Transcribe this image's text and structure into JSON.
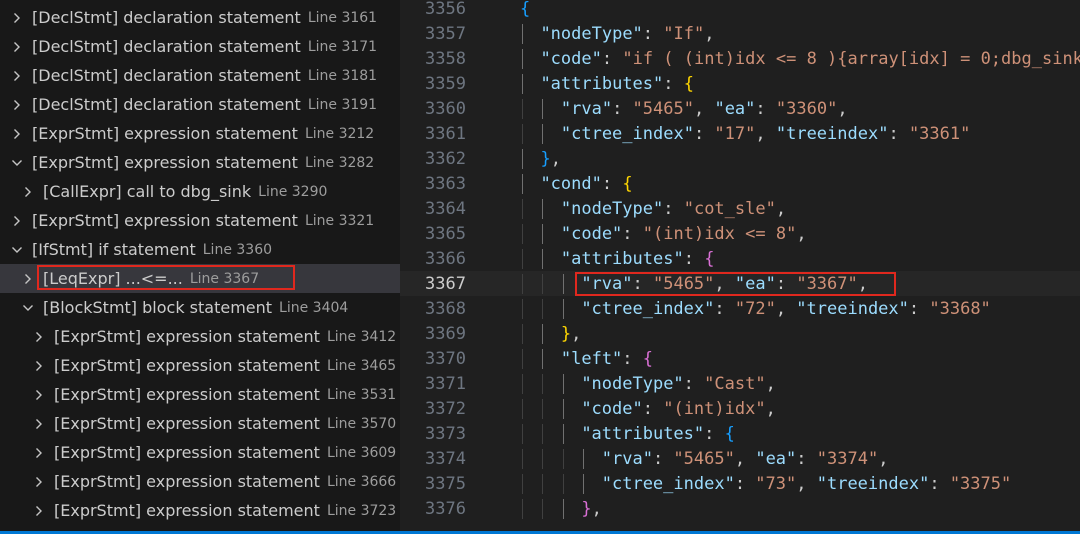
{
  "outline": {
    "items": [
      {
        "label": "[DeclStmt] declaration statement",
        "line": "Line 3161",
        "chevron": "right"
      },
      {
        "label": "[DeclStmt] declaration statement",
        "line": "Line 3171",
        "chevron": "right"
      },
      {
        "label": "[DeclStmt] declaration statement",
        "line": "Line 3181",
        "chevron": "right"
      },
      {
        "label": "[DeclStmt] declaration statement",
        "line": "Line 3191",
        "chevron": "right"
      },
      {
        "label": "[ExprStmt] expression statement",
        "line": "Line 3212",
        "chevron": "right"
      },
      {
        "label": "[ExprStmt] expression statement",
        "line": "Line 3282",
        "chevron": "down"
      },
      {
        "label": "[CallExpr] call to dbg_sink",
        "line": "Line 3290",
        "chevron": "right"
      },
      {
        "label": "[ExprStmt] expression statement",
        "line": "Line 3321",
        "chevron": "right"
      },
      {
        "label": "[IfStmt] if statement",
        "line": "Line 3360",
        "chevron": "down"
      },
      {
        "label": "[LeqExpr] ...<=...",
        "line": "Line 3367",
        "chevron": "right"
      },
      {
        "label": "[BlockStmt] block statement",
        "line": "Line 3404",
        "chevron": "down"
      },
      {
        "label": "[ExprStmt] expression statement",
        "line": "Line 3412",
        "chevron": "right"
      },
      {
        "label": "[ExprStmt] expression statement",
        "line": "Line 3465",
        "chevron": "right"
      },
      {
        "label": "[ExprStmt] expression statement",
        "line": "Line 3531",
        "chevron": "right"
      },
      {
        "label": "[ExprStmt] expression statement",
        "line": "Line 3570",
        "chevron": "right"
      },
      {
        "label": "[ExprStmt] expression statement",
        "line": "Line 3609",
        "chevron": "right"
      },
      {
        "label": "[ExprStmt] expression statement",
        "line": "Line 3666",
        "chevron": "right"
      },
      {
        "label": "[ExprStmt] expression statement",
        "line": "Line 3723",
        "chevron": "right"
      }
    ]
  },
  "editor": {
    "current_line": "3367",
    "lines": [
      {
        "n": "3356",
        "code": "{"
      },
      {
        "n": "3357",
        "code": "\"nodeType\": \"If\","
      },
      {
        "n": "3358",
        "code": "\"code\": \"if ( (int)idx <= 8 ){array[idx] = 0;dbg_sink"
      },
      {
        "n": "3359",
        "code": "\"attributes\": {"
      },
      {
        "n": "3360",
        "code": "\"rva\": \"5465\", \"ea\": \"3360\","
      },
      {
        "n": "3361",
        "code": "\"ctree_index\": \"17\", \"treeindex\": \"3361\""
      },
      {
        "n": "3362",
        "code": "},"
      },
      {
        "n": "3363",
        "code": "\"cond\": {"
      },
      {
        "n": "3364",
        "code": "\"nodeType\": \"cot_sle\","
      },
      {
        "n": "3365",
        "code": "\"code\": \"(int)idx <= 8\","
      },
      {
        "n": "3366",
        "code": "\"attributes\": {"
      },
      {
        "n": "3367",
        "code": "\"rva\": \"5465\", \"ea\": \"3367\","
      },
      {
        "n": "3368",
        "code": "\"ctree_index\": \"72\", \"treeindex\": \"3368\""
      },
      {
        "n": "3369",
        "code": "},"
      },
      {
        "n": "3370",
        "code": "\"left\": {"
      },
      {
        "n": "3371",
        "code": "\"nodeType\": \"Cast\","
      },
      {
        "n": "3372",
        "code": "\"code\": \"(int)idx\","
      },
      {
        "n": "3373",
        "code": "\"attributes\": {"
      },
      {
        "n": "3374",
        "code": "\"rva\": \"5465\", \"ea\": \"3374\","
      },
      {
        "n": "3375",
        "code": "\"ctree_index\": \"73\", \"treeindex\": \"3375\""
      },
      {
        "n": "3376",
        "code": "},"
      }
    ]
  },
  "colors": {
    "highlight_box": "#e0281e",
    "key": "#9cdcfe",
    "string": "#ce9178",
    "bracket_level1": "#179fff",
    "bracket_level2": "#ffd700",
    "bracket_level3": "#da70d6"
  },
  "icons": {
    "collapsed": "chevron-right-icon",
    "expanded": "chevron-down-icon"
  }
}
